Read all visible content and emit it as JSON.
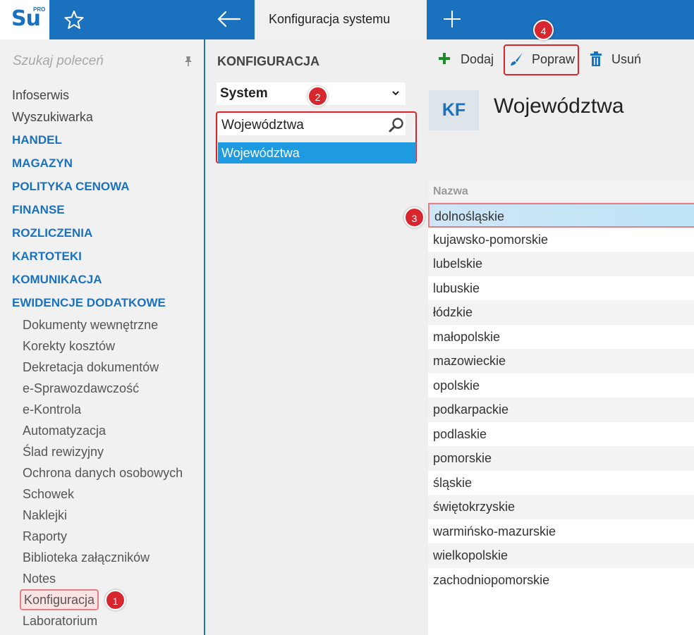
{
  "app": {
    "logo_text": "Su",
    "logo_badge": "PRO",
    "active_tab": "Konfiguracja systemu"
  },
  "sidebar": {
    "search_placeholder": "Szukaj poleceń",
    "top_items": [
      "Infoserwis",
      "Wyszukiwarka"
    ],
    "categories": [
      "HANDEL",
      "MAGAZYN",
      "POLITYKA CENOWA",
      "FINANSE",
      "ROZLICZENIA",
      "KARTOTEKI",
      "KOMUNIKACJA",
      "EWIDENCJE DODATKOWE"
    ],
    "sub_items": [
      "Dokumenty wewnętrzne",
      "Korekty kosztów",
      "Dekretacja dokumentów",
      "e-Sprawozdawczość",
      "e-Kontrola",
      "Automatyzacja",
      "Ślad rewizyjny",
      "Ochrona danych osobowych",
      "Schowek",
      "Naklejki",
      "Raporty",
      "Biblioteka załączników",
      "Notes",
      "Konfiguracja",
      "Laboratorium"
    ]
  },
  "config_panel": {
    "title": "KONFIGURACJA",
    "system_select": "System",
    "filter_value": "Województwa",
    "filter_result": "Województwa"
  },
  "toolbar": {
    "add_label": "Dodaj",
    "edit_label": "Popraw",
    "delete_label": "Usuń"
  },
  "content": {
    "badge": "KF",
    "title": "Województwa",
    "column_header": "Nazwa",
    "rows": [
      "dolnośląskie",
      "kujawsko-pomorskie",
      "lubelskie",
      "lubuskie",
      "łódzkie",
      "małopolskie",
      "mazowieckie",
      "opolskie",
      "podkarpackie",
      "podlaskie",
      "pomorskie",
      "śląskie",
      "świętokrzyskie",
      "warmińsko-mazurskie",
      "wielkopolskie",
      "zachodniopomorskie"
    ]
  },
  "markers": [
    "1",
    "2",
    "3",
    "4"
  ],
  "colors": {
    "brand": "#1a72bf",
    "marker": "#d8262e",
    "selection": "#1e9ae0",
    "add_icon": "#1e8a2e"
  }
}
